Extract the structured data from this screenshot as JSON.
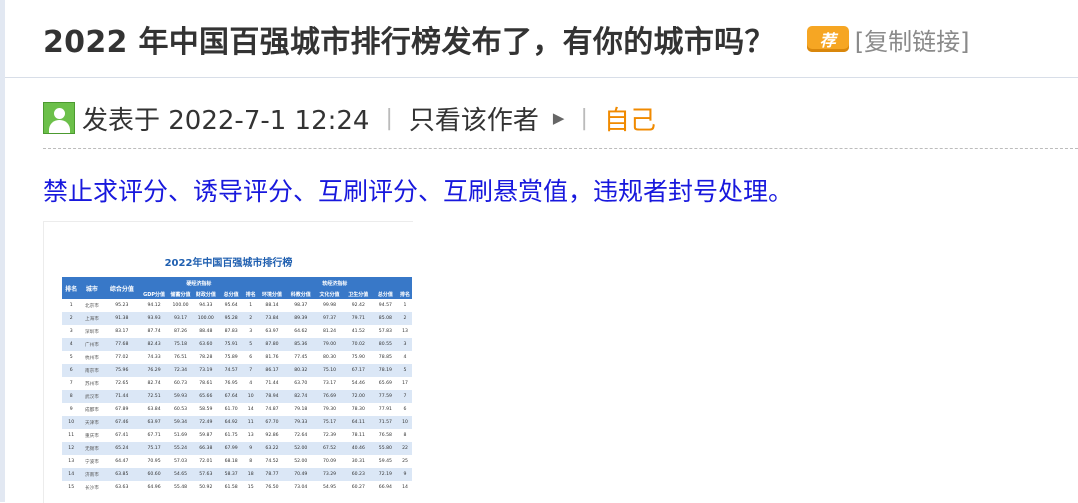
{
  "post": {
    "title": "2022 年中国百强城市排行榜发布了，有你的城市吗？",
    "badge_text": "荐",
    "copy_link": "[复制链接]"
  },
  "meta": {
    "posted_label": "发表于 2022-7-1 12:24",
    "separator": "|",
    "author_only": "只看该作者",
    "self_label": "自己"
  },
  "notice": "禁止求评分、诱导评分、互刷评分、互刷悬赏值，违规者封号处理。",
  "ranking_image": {
    "title": "2022年中国百强城市排行榜",
    "group_headers": {
      "rank": "排名",
      "city": "城市",
      "total": "综合分值",
      "hard": "硬经济指标",
      "soft": "软经济指标"
    },
    "sub_headers": [
      "GDP分值",
      "储蓄分值",
      "财政分值",
      "总分值",
      "排名",
      "环境分值",
      "科教分值",
      "文化分值",
      "卫生分值",
      "总分值",
      "排名"
    ],
    "rows": [
      [
        "1",
        "北京市",
        "95.23",
        "94.12",
        "100.00",
        "94.33",
        "95.64",
        "1",
        "88.14",
        "98.37",
        "99.98",
        "92.42",
        "94.57",
        "1"
      ],
      [
        "2",
        "上海市",
        "91.38",
        "93.93",
        "93.17",
        "100.00",
        "95.28",
        "2",
        "73.84",
        "89.39",
        "97.37",
        "79.71",
        "85.08",
        "2"
      ],
      [
        "3",
        "深圳市",
        "83.17",
        "87.74",
        "87.26",
        "88.48",
        "87.83",
        "3",
        "63.97",
        "64.62",
        "81.24",
        "41.52",
        "57.83",
        "13"
      ],
      [
        "4",
        "广州市",
        "77.68",
        "82.43",
        "75.18",
        "63.60",
        "75.91",
        "5",
        "87.80",
        "85.36",
        "79.00",
        "70.02",
        "80.55",
        "3"
      ],
      [
        "5",
        "杭州市",
        "77.02",
        "74.33",
        "76.51",
        "78.28",
        "75.89",
        "6",
        "81.76",
        "77.45",
        "80.30",
        "75.90",
        "78.85",
        "4"
      ],
      [
        "6",
        "南京市",
        "75.96",
        "76.29",
        "72.34",
        "73.19",
        "74.57",
        "7",
        "86.17",
        "80.32",
        "75.10",
        "67.17",
        "78.19",
        "5"
      ],
      [
        "7",
        "苏州市",
        "72.65",
        "82.74",
        "60.73",
        "78.61",
        "76.95",
        "4",
        "71.44",
        "63.70",
        "73.17",
        "54.46",
        "65.69",
        "17"
      ],
      [
        "8",
        "武汉市",
        "71.44",
        "72.51",
        "59.93",
        "65.66",
        "67.64",
        "10",
        "78.94",
        "82.74",
        "76.69",
        "72.00",
        "77.59",
        "7"
      ],
      [
        "9",
        "成都市",
        "67.89",
        "63.84",
        "60.53",
        "58.59",
        "61.70",
        "14",
        "74.87",
        "79.18",
        "79.30",
        "78.30",
        "77.91",
        "6"
      ],
      [
        "10",
        "天津市",
        "67.46",
        "63.97",
        "59.34",
        "72.49",
        "64.92",
        "11",
        "67.70",
        "79.33",
        "75.17",
        "64.11",
        "71.57",
        "10"
      ],
      [
        "11",
        "重庆市",
        "67.41",
        "67.71",
        "51.69",
        "59.87",
        "61.75",
        "13",
        "92.86",
        "72.64",
        "72.39",
        "78.11",
        "76.58",
        "8"
      ],
      [
        "12",
        "无锡市",
        "65.24",
        "75.17",
        "55.24",
        "66.38",
        "67.99",
        "9",
        "63.22",
        "52.00",
        "67.52",
        "40.46",
        "55.80",
        "22"
      ],
      [
        "13",
        "宁波市",
        "64.47",
        "70.95",
        "57.03",
        "72.01",
        "68.18",
        "8",
        "74.52",
        "52.00",
        "70.09",
        "30.31",
        "59.45",
        "25"
      ],
      [
        "14",
        "济南市",
        "63.85",
        "60.60",
        "54.65",
        "57.63",
        "58.37",
        "18",
        "78.77",
        "70.49",
        "73.29",
        "60.23",
        "72.19",
        "9"
      ],
      [
        "15",
        "长沙市",
        "63.63",
        "64.96",
        "55.48",
        "50.92",
        "61.58",
        "15",
        "76.50",
        "73.04",
        "54.95",
        "60.27",
        "66.94",
        "14"
      ]
    ]
  }
}
